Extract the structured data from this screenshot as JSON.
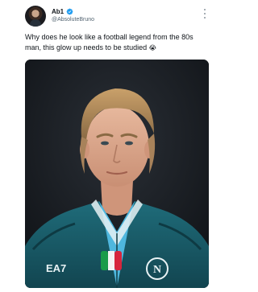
{
  "post": {
    "author": {
      "display_name": "Ab1",
      "handle": "@AbsoluteBruno",
      "verified": true,
      "avatar": "avatar-photo"
    },
    "text_line1": "Why does he look like a football legend from the 80s",
    "text_line2": "man, this glow up needs to be studied",
    "emoji": "😭",
    "menu_icon": "more-options-icon",
    "media": {
      "kit_logo": "EA7",
      "crest_letter": "N",
      "colors": {
        "jersey": "#1f6c7a",
        "jersey_dark": "#124550",
        "shirt": "#4fb7de",
        "background": "#14171c",
        "verified": "#1d9bf0"
      }
    }
  }
}
